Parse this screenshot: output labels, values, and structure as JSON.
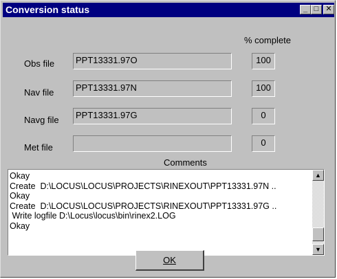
{
  "window": {
    "title": "Conversion status"
  },
  "header": {
    "percent_label": "% complete"
  },
  "rows": [
    {
      "label": "Obs file",
      "value": "PPT13331.97O",
      "percent": "100"
    },
    {
      "label": "Nav file",
      "value": "PPT13331.97N",
      "percent": "100"
    },
    {
      "label": "Navg file",
      "value": "PPT13331.97G",
      "percent": "0"
    },
    {
      "label": "Met file",
      "value": "",
      "percent": "0"
    }
  ],
  "comments": {
    "label": "Comments",
    "lines": [
      "Okay",
      "Create  D:\\LOCUS\\LOCUS\\PROJECTS\\RINEXOUT\\PPT13331.97N ..",
      "Okay",
      "Create  D:\\LOCUS\\LOCUS\\PROJECTS\\RINEXOUT\\PPT13331.97G ..",
      " Write logfile D:\\Locus\\locus\\bin\\rinex2.LOG",
      "Okay"
    ]
  },
  "buttons": {
    "ok": "OK"
  },
  "icons": {
    "minimize": "minimize-icon",
    "maximize": "maximize-icon",
    "close": "close-icon",
    "scroll_up": "arrow-up-icon",
    "scroll_down": "arrow-down-icon"
  },
  "colors": {
    "titlebar": "#000080",
    "face": "#c0c0c0"
  }
}
